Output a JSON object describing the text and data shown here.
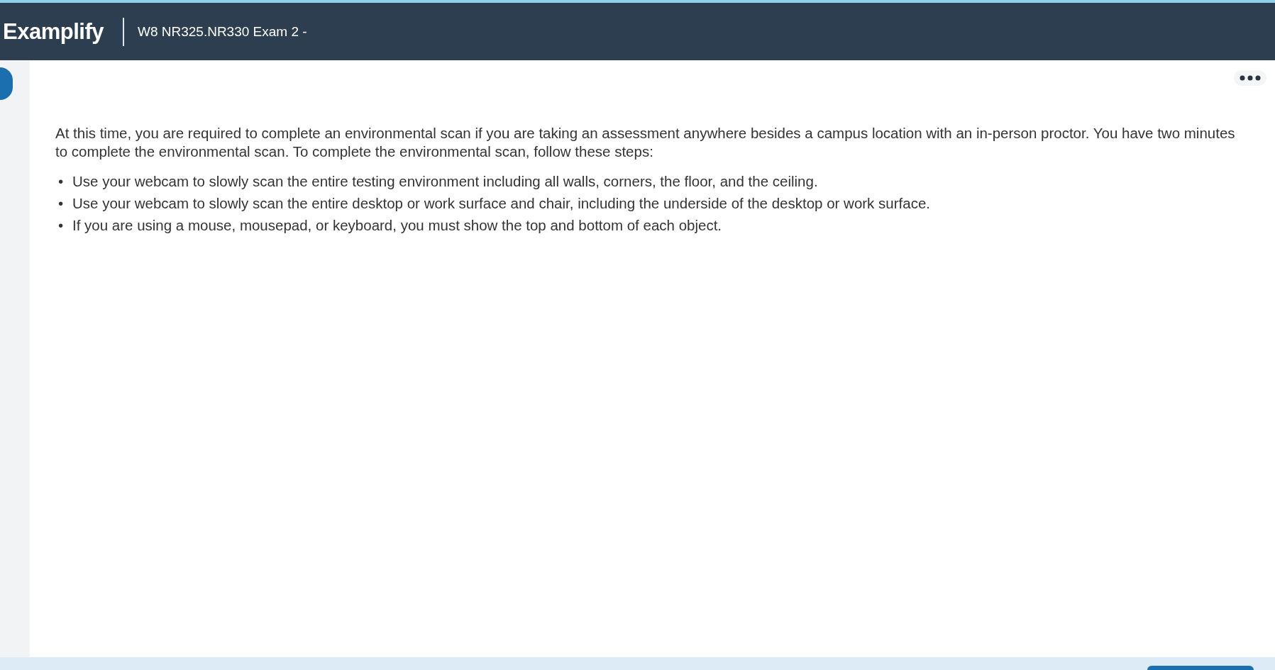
{
  "header": {
    "logo": "Examplify",
    "title": "W8 NR325.NR330 Exam 2 -"
  },
  "instructions": {
    "intro": "At this time, you are required to complete an environmental scan if you are taking an assessment anywhere besides a campus location with an in-person proctor. You have two minutes to complete the environmental scan. To complete the environmental scan, follow these steps:",
    "steps": [
      {
        "marker": "•",
        "text": "Use your webcam to slowly scan the entire testing environment including all walls, corners, the floor, and the ceiling."
      },
      {
        "marker": "•",
        "text": "Use your webcam to slowly scan the entire desktop or work surface and chair, including the underside of the desktop or work surface."
      },
      {
        "marker": "•",
        "text": "If you are using a mouse, mousepad, or keyboard, you must show the top and bottom of each object."
      }
    ]
  }
}
